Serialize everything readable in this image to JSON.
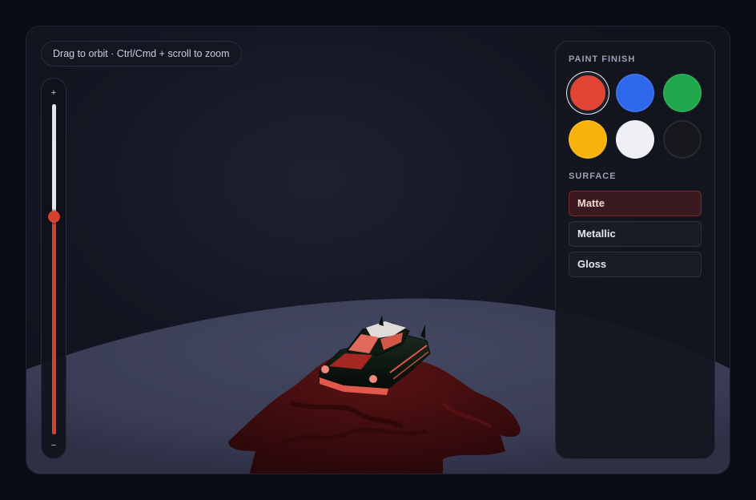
{
  "hint": {
    "text": "Drag to orbit · Ctrl/Cmd + scroll to zoom"
  },
  "zoom": {
    "plus_label": "+",
    "minus_label": "−",
    "level": 0.66,
    "fill_color": "#d6402f"
  },
  "paint_finish": {
    "title": "PAINT FINISH",
    "selected": "red",
    "swatches": [
      {
        "id": "red",
        "color": "#e04433"
      },
      {
        "id": "blue",
        "color": "#2e67ea"
      },
      {
        "id": "green",
        "color": "#1fa64a"
      },
      {
        "id": "yellow",
        "color": "#f5b20b"
      },
      {
        "id": "white",
        "color": "#eef0f4"
      },
      {
        "id": "black",
        "color": "#17181c"
      }
    ]
  },
  "surface": {
    "title": "SURFACE",
    "active": "matte",
    "options": [
      {
        "id": "matte",
        "label": "Matte"
      },
      {
        "id": "metallic",
        "label": "Metallic"
      },
      {
        "id": "gloss",
        "label": "Gloss"
      }
    ]
  },
  "scene": {
    "floor_color": "#3b3e58",
    "cloth_color": "#4a0e10",
    "car_body_color": "#0d1a12",
    "car_accent_color": "#e0584a"
  }
}
